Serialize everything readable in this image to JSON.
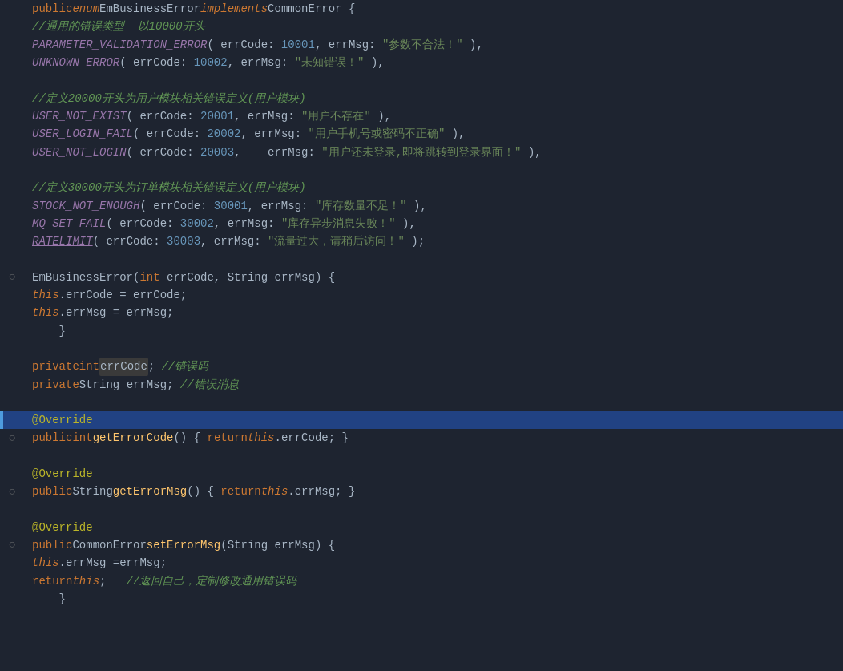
{
  "editor": {
    "background": "#1e2430",
    "highlight_color": "#214283",
    "lines": [
      {
        "id": 1,
        "tokens": [
          {
            "t": "kw",
            "v": "public"
          },
          {
            "t": "plain",
            "v": " "
          },
          {
            "t": "kw2",
            "v": "enum"
          },
          {
            "t": "plain",
            "v": " "
          },
          {
            "t": "cls",
            "v": "EmBusinessError"
          },
          {
            "t": "plain",
            "v": " "
          },
          {
            "t": "kw2",
            "v": "implements"
          },
          {
            "t": "plain",
            "v": " "
          },
          {
            "t": "iface",
            "v": "CommonError"
          },
          {
            "t": "plain",
            "v": " {"
          }
        ],
        "gutter": ""
      },
      {
        "id": 2,
        "tokens": [
          {
            "t": "plain",
            "v": "    "
          },
          {
            "t": "comment-cn",
            "v": "//通用的错误类型  以10000开头"
          }
        ],
        "gutter": ""
      },
      {
        "id": 3,
        "tokens": [
          {
            "t": "plain",
            "v": "    "
          },
          {
            "t": "enum-val",
            "v": "PARAMETER_VALIDATION_ERROR"
          },
          {
            "t": "plain",
            "v": "( errCode: "
          },
          {
            "t": "num",
            "v": "10001"
          },
          {
            "t": "plain",
            "v": ", errMsg: "
          },
          {
            "t": "str",
            "v": "\"参数不合法！\""
          },
          {
            "t": "plain",
            "v": " ),"
          }
        ],
        "gutter": ""
      },
      {
        "id": 4,
        "tokens": [
          {
            "t": "plain",
            "v": "    "
          },
          {
            "t": "enum-val",
            "v": "UNKNOWN_ERROR"
          },
          {
            "t": "plain",
            "v": "( errCode: "
          },
          {
            "t": "num",
            "v": "10002"
          },
          {
            "t": "plain",
            "v": ", errMsg: "
          },
          {
            "t": "str",
            "v": "\"未知错误！\""
          },
          {
            "t": "plain",
            "v": " ),"
          }
        ],
        "gutter": ""
      },
      {
        "id": 5,
        "tokens": [],
        "gutter": ""
      },
      {
        "id": 6,
        "tokens": [
          {
            "t": "plain",
            "v": "    "
          },
          {
            "t": "comment-cn",
            "v": "//定义20000开头为用户模块相关错误定义(用户模块)"
          }
        ],
        "gutter": ""
      },
      {
        "id": 7,
        "tokens": [
          {
            "t": "plain",
            "v": "    "
          },
          {
            "t": "enum-val",
            "v": "USER_NOT_EXIST"
          },
          {
            "t": "plain",
            "v": "( errCode: "
          },
          {
            "t": "num",
            "v": "20001"
          },
          {
            "t": "plain",
            "v": ", errMsg: "
          },
          {
            "t": "str",
            "v": "\"用户不存在\""
          },
          {
            "t": "plain",
            "v": " ),"
          }
        ],
        "gutter": ""
      },
      {
        "id": 8,
        "tokens": [
          {
            "t": "plain",
            "v": "    "
          },
          {
            "t": "enum-val",
            "v": "USER_LOGIN_FAIL"
          },
          {
            "t": "plain",
            "v": "( errCode: "
          },
          {
            "t": "num",
            "v": "20002"
          },
          {
            "t": "plain",
            "v": ", errMsg: "
          },
          {
            "t": "str",
            "v": "\"用户手机号或密码不正确\""
          },
          {
            "t": "plain",
            "v": " ),"
          }
        ],
        "gutter": ""
      },
      {
        "id": 9,
        "tokens": [
          {
            "t": "plain",
            "v": "    "
          },
          {
            "t": "enum-val",
            "v": "USER_NOT_LOGIN"
          },
          {
            "t": "plain",
            "v": "( errCode: "
          },
          {
            "t": "num",
            "v": "20003"
          },
          {
            "t": "plain",
            "v": ",    errMsg: "
          },
          {
            "t": "str",
            "v": "\"用户还未登录,即将跳转到登录界面！\""
          },
          {
            "t": "plain",
            "v": " ),"
          }
        ],
        "gutter": ""
      },
      {
        "id": 10,
        "tokens": [],
        "gutter": ""
      },
      {
        "id": 11,
        "tokens": [
          {
            "t": "plain",
            "v": "    "
          },
          {
            "t": "comment-cn",
            "v": "//定义30000开头为订单模块相关错误定义(用户模块)"
          }
        ],
        "gutter": ""
      },
      {
        "id": 12,
        "tokens": [
          {
            "t": "plain",
            "v": "    "
          },
          {
            "t": "enum-val",
            "v": "STOCK_NOT_ENOUGH"
          },
          {
            "t": "plain",
            "v": "( errCode: "
          },
          {
            "t": "num",
            "v": "30001"
          },
          {
            "t": "plain",
            "v": ", errMsg: "
          },
          {
            "t": "str",
            "v": "\"库存数量不足！\""
          },
          {
            "t": "plain",
            "v": " ),"
          }
        ],
        "gutter": ""
      },
      {
        "id": 13,
        "tokens": [
          {
            "t": "plain",
            "v": "    "
          },
          {
            "t": "enum-val",
            "v": "MQ_SET_FAIL"
          },
          {
            "t": "plain",
            "v": "( errCode: "
          },
          {
            "t": "num",
            "v": "30002"
          },
          {
            "t": "plain",
            "v": ", errMsg: "
          },
          {
            "t": "str",
            "v": "\"库存异步消息失败！\""
          },
          {
            "t": "plain",
            "v": " ),"
          }
        ],
        "gutter": ""
      },
      {
        "id": 14,
        "tokens": [
          {
            "t": "plain",
            "v": "    "
          },
          {
            "t": "enum-val",
            "v": "RATELIMIT"
          },
          {
            "t": "plain",
            "v": "( errCode: "
          },
          {
            "t": "num",
            "v": "30003"
          },
          {
            "t": "plain",
            "v": ", errMsg: "
          },
          {
            "t": "str",
            "v": "\"流量过大，请稍后访问！\""
          },
          {
            "t": "plain",
            "v": " );"
          }
        ],
        "gutter": "underline"
      },
      {
        "id": 15,
        "tokens": [],
        "gutter": ""
      },
      {
        "id": 16,
        "tokens": [
          {
            "t": "plain",
            "v": "    "
          },
          {
            "t": "cls",
            "v": "EmBusinessError"
          },
          {
            "t": "plain",
            "v": "("
          },
          {
            "t": "type",
            "v": "int"
          },
          {
            "t": "plain",
            "v": " errCode, "
          },
          {
            "t": "cls",
            "v": "String"
          },
          {
            "t": "plain",
            "v": " errMsg) {"
          }
        ],
        "gutter": "fold"
      },
      {
        "id": 17,
        "tokens": [
          {
            "t": "plain",
            "v": "        "
          },
          {
            "t": "this-kw",
            "v": "this"
          },
          {
            "t": "plain",
            "v": ".errCode = errCode;"
          }
        ],
        "gutter": ""
      },
      {
        "id": 18,
        "tokens": [
          {
            "t": "plain",
            "v": "        "
          },
          {
            "t": "this-kw",
            "v": "this"
          },
          {
            "t": "plain",
            "v": ".errMsg = errMsg;"
          }
        ],
        "gutter": ""
      },
      {
        "id": 19,
        "tokens": [
          {
            "t": "plain",
            "v": "    }"
          }
        ],
        "gutter": ""
      },
      {
        "id": 20,
        "tokens": [],
        "gutter": ""
      },
      {
        "id": 21,
        "tokens": [
          {
            "t": "plain",
            "v": "    "
          },
          {
            "t": "kw",
            "v": "private"
          },
          {
            "t": "plain",
            "v": " "
          },
          {
            "t": "type",
            "v": "int"
          },
          {
            "t": "plain",
            "v": " "
          },
          {
            "t": "field-hl",
            "v": "errCode"
          },
          {
            "t": "plain",
            "v": "; "
          },
          {
            "t": "comment-cn",
            "v": "//错误码"
          }
        ],
        "gutter": ""
      },
      {
        "id": 22,
        "tokens": [
          {
            "t": "plain",
            "v": "    "
          },
          {
            "t": "kw",
            "v": "private"
          },
          {
            "t": "plain",
            "v": " "
          },
          {
            "t": "cls",
            "v": "String"
          },
          {
            "t": "plain",
            "v": " errMsg; "
          },
          {
            "t": "comment-cn",
            "v": "//错误消息"
          }
        ],
        "gutter": ""
      },
      {
        "id": 23,
        "tokens": [],
        "gutter": ""
      },
      {
        "id": 24,
        "tokens": [
          {
            "t": "plain",
            "v": "    "
          },
          {
            "t": "annotation",
            "v": "@Override"
          }
        ],
        "gutter": "",
        "highlighted": true
      },
      {
        "id": 25,
        "tokens": [
          {
            "t": "plain",
            "v": "    "
          },
          {
            "t": "kw",
            "v": "public"
          },
          {
            "t": "plain",
            "v": " "
          },
          {
            "t": "type",
            "v": "int"
          },
          {
            "t": "plain",
            "v": " "
          },
          {
            "t": "method",
            "v": "getErrorCode"
          },
          {
            "t": "plain",
            "v": "() { "
          },
          {
            "t": "kw",
            "v": "return"
          },
          {
            "t": "plain",
            "v": " "
          },
          {
            "t": "this-kw",
            "v": "this"
          },
          {
            "t": "plain",
            "v": ".errCode; }"
          }
        ],
        "gutter": "fold"
      },
      {
        "id": 26,
        "tokens": [],
        "gutter": ""
      },
      {
        "id": 27,
        "tokens": [
          {
            "t": "plain",
            "v": "    "
          },
          {
            "t": "annotation",
            "v": "@Override"
          }
        ],
        "gutter": ""
      },
      {
        "id": 28,
        "tokens": [
          {
            "t": "plain",
            "v": "    "
          },
          {
            "t": "kw",
            "v": "public"
          },
          {
            "t": "plain",
            "v": " "
          },
          {
            "t": "cls",
            "v": "String"
          },
          {
            "t": "plain",
            "v": " "
          },
          {
            "t": "method",
            "v": "getErrorMsg"
          },
          {
            "t": "plain",
            "v": "() { "
          },
          {
            "t": "kw",
            "v": "return"
          },
          {
            "t": "plain",
            "v": " "
          },
          {
            "t": "this-kw",
            "v": "this"
          },
          {
            "t": "plain",
            "v": ".errMsg; }"
          }
        ],
        "gutter": "fold"
      },
      {
        "id": 29,
        "tokens": [],
        "gutter": ""
      },
      {
        "id": 30,
        "tokens": [
          {
            "t": "plain",
            "v": "    "
          },
          {
            "t": "annotation",
            "v": "@Override"
          }
        ],
        "gutter": ""
      },
      {
        "id": 31,
        "tokens": [
          {
            "t": "plain",
            "v": "    "
          },
          {
            "t": "kw",
            "v": "public"
          },
          {
            "t": "plain",
            "v": " "
          },
          {
            "t": "cls",
            "v": "CommonError"
          },
          {
            "t": "plain",
            "v": " "
          },
          {
            "t": "method",
            "v": "setErrorMsg"
          },
          {
            "t": "plain",
            "v": "("
          },
          {
            "t": "cls",
            "v": "String"
          },
          {
            "t": "plain",
            "v": " errMsg) {"
          }
        ],
        "gutter": "fold"
      },
      {
        "id": 32,
        "tokens": [
          {
            "t": "plain",
            "v": "        "
          },
          {
            "t": "this-kw",
            "v": "this"
          },
          {
            "t": "plain",
            "v": ".errMsg =errMsg;"
          }
        ],
        "gutter": ""
      },
      {
        "id": 33,
        "tokens": [
          {
            "t": "plain",
            "v": "        "
          },
          {
            "t": "kw",
            "v": "return"
          },
          {
            "t": "plain",
            "v": " "
          },
          {
            "t": "this-kw",
            "v": "this"
          },
          {
            "t": "plain",
            "v": ";   "
          },
          {
            "t": "comment-cn",
            "v": "//返回自己，定制修改通用错误码"
          }
        ],
        "gutter": ""
      },
      {
        "id": 34,
        "tokens": [
          {
            "t": "plain",
            "v": "    }"
          }
        ],
        "gutter": ""
      }
    ]
  }
}
